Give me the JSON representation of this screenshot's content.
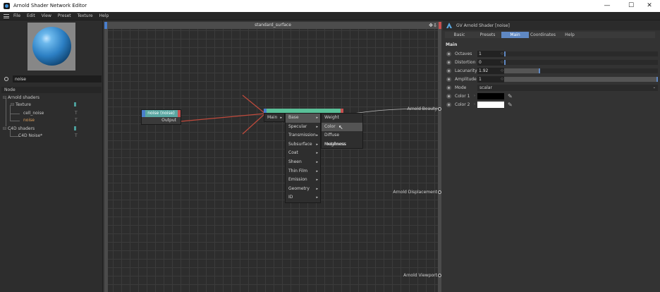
{
  "window": {
    "title": "Arnold Shader Network Editor",
    "controls": {
      "minimize": "—",
      "maximize": "☐",
      "close": "✕"
    }
  },
  "menubar": {
    "items": [
      "File",
      "Edit",
      "View",
      "Preset",
      "Texture",
      "Help"
    ]
  },
  "left_panel": {
    "search_value": "noise",
    "tree_header": "Node",
    "tree": [
      {
        "label": "Arnold shaders",
        "color": "#c8c8c8"
      },
      {
        "label": "Texture",
        "color": "#c8c8c8"
      },
      {
        "label": "cell_noise",
        "color": "#c8c8c8",
        "mark": "T"
      },
      {
        "label": "noise",
        "color": "#e0a05a",
        "mark": "T"
      },
      {
        "label": "C4D shaders",
        "color": "#c8c8c8"
      },
      {
        "label": "C4D Noise*",
        "color": "#c8c8c8",
        "mark": "T"
      }
    ]
  },
  "editor": {
    "title": "standard_surface",
    "noise_node": {
      "title": "noise (noise)",
      "output": "Output"
    },
    "context_menu": {
      "level1": [
        "Main"
      ],
      "level2": [
        "Base",
        "Specular",
        "Transmission",
        "Subsurface",
        "Coat",
        "Sheen",
        "Thin Film",
        "Emission",
        "Geometry",
        "ID"
      ],
      "level3": [
        "Weight",
        "Color",
        "Diffuse roughness",
        "Metalness"
      ],
      "highlighted": "Color"
    },
    "ports": [
      "Arnold Beauty",
      "Arnold Displacement",
      "Arnold Viewport"
    ]
  },
  "right_panel": {
    "title": "GV Arnold Shader [noise]",
    "tabs": [
      "Basic",
      "Presets",
      "Main",
      "Coordinates",
      "Help"
    ],
    "active_tab": "Main",
    "section": "Main",
    "params": [
      {
        "label": "Octaves",
        "value": "1",
        "fill": 0.0
      },
      {
        "label": "Distortion",
        "value": "0",
        "fill": 0.0
      },
      {
        "label": "Lacunarity",
        "value": "1.92",
        "fill": 0.23
      },
      {
        "label": "Amplitude",
        "value": "1",
        "fill": 1.0
      }
    ],
    "mode": {
      "label": "Mode",
      "value": "scalar"
    },
    "colors": [
      {
        "label": "Color 1",
        "hex": "#000000"
      },
      {
        "label": "Color 2",
        "hex": "#ffffff"
      }
    ]
  }
}
